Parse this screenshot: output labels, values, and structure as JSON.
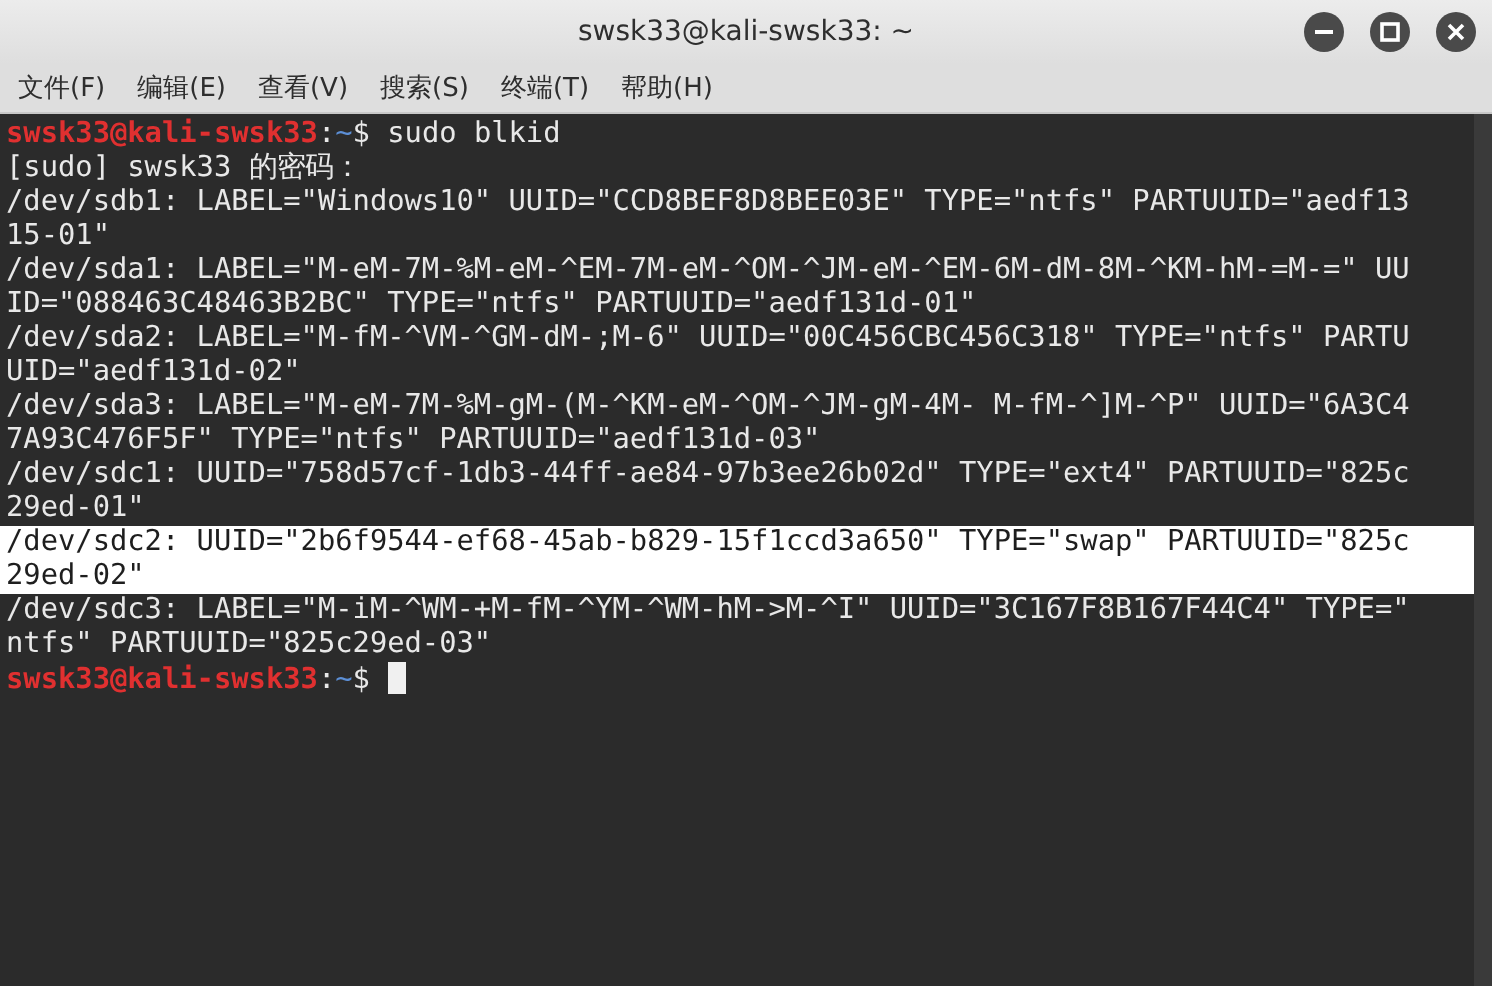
{
  "window": {
    "title": "swsk33@kali-swsk33: ~"
  },
  "menu": [
    {
      "label": "文件(F)"
    },
    {
      "label": "编辑(E)"
    },
    {
      "label": "查看(V)"
    },
    {
      "label": "搜索(S)"
    },
    {
      "label": "终端(T)"
    },
    {
      "label": "帮助(H)"
    }
  ],
  "terminal": {
    "lines": [
      {
        "kind": "prompt",
        "user_host": "swsk33@kali-swsk33",
        "separator": ":",
        "path": "~",
        "symbol": "$",
        "command": "sudo blkid",
        "cursor": false,
        "selected": false
      },
      {
        "kind": "output",
        "text": "[sudo] swsk33 的密码：",
        "selected": false
      },
      {
        "kind": "output",
        "text": "/dev/sdb1: LABEL=\"Windows10\" UUID=\"CCD8BEF8D8BEE03E\" TYPE=\"ntfs\" PARTUUID=\"aedf13",
        "selected": false
      },
      {
        "kind": "output",
        "text": "15-01\"",
        "selected": false
      },
      {
        "kind": "output",
        "text": "/dev/sda1: LABEL=\"M-eM-7M-%M-eM-^EM-7M-eM-^OM-^JM-eM-^EM-6M-dM-8M-^KM-hM-=M-=\" UU",
        "selected": false
      },
      {
        "kind": "output",
        "text": "ID=\"088463C48463B2BC\" TYPE=\"ntfs\" PARTUUID=\"aedf131d-01\"",
        "selected": false
      },
      {
        "kind": "output",
        "text": "/dev/sda2: LABEL=\"M-fM-^VM-^GM-dM-;M-6\" UUID=\"00C456CBC456C318\" TYPE=\"ntfs\" PARTU",
        "selected": false
      },
      {
        "kind": "output",
        "text": "UID=\"aedf131d-02\"",
        "selected": false
      },
      {
        "kind": "output",
        "text": "/dev/sda3: LABEL=\"M-eM-7M-%M-gM-(M-^KM-eM-^OM-^JM-gM-4M- M-fM-^]M-^P\" UUID=\"6A3C4",
        "selected": false
      },
      {
        "kind": "output",
        "text": "7A93C476F5F\" TYPE=\"ntfs\" PARTUUID=\"aedf131d-03\"",
        "selected": false
      },
      {
        "kind": "output",
        "text": "/dev/sdc1: UUID=\"758d57cf-1db3-44ff-ae84-97b3ee26b02d\" TYPE=\"ext4\" PARTUUID=\"825c",
        "selected": false
      },
      {
        "kind": "output",
        "text": "29ed-01\"",
        "selected": false
      },
      {
        "kind": "output",
        "text": "/dev/sdc2: UUID=\"2b6f9544-ef68-45ab-b829-15f1ccd3a650\" TYPE=\"swap\" PARTUUID=\"825c",
        "selected": true
      },
      {
        "kind": "output",
        "text": "29ed-02\"",
        "selected": true
      },
      {
        "kind": "output",
        "text": "/dev/sdc3: LABEL=\"M-iM-^WM-+M-fM-^YM-^WM-hM->M-^I\" UUID=\"3C167F8B167F44C4\" TYPE=\"",
        "selected": false
      },
      {
        "kind": "output",
        "text": "ntfs\" PARTUUID=\"825c29ed-03\"",
        "selected": false
      },
      {
        "kind": "prompt",
        "user_host": "swsk33@kali-swsk33",
        "separator": ":",
        "path": "~",
        "symbol": "$",
        "cursor": true,
        "selected": false
      }
    ]
  }
}
